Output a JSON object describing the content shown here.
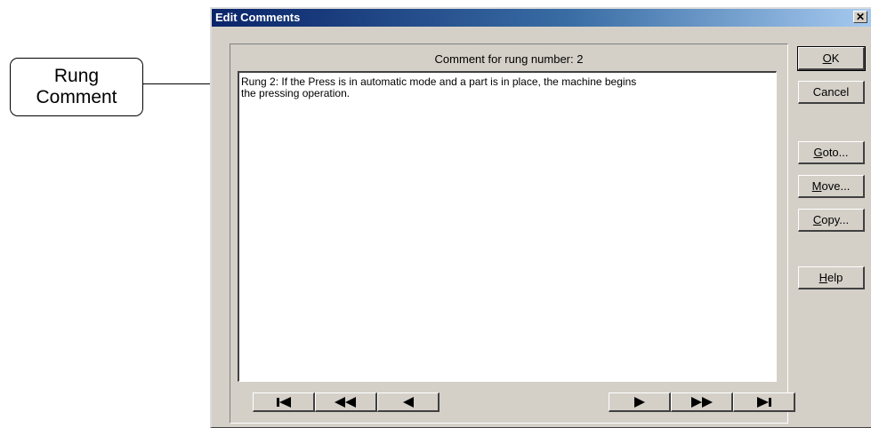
{
  "callout": {
    "line1": "Rung",
    "line2": "Comment"
  },
  "window": {
    "title": "Edit Comments",
    "close_glyph": "✕"
  },
  "panel": {
    "label": "Comment for rung number: 2",
    "comment_text": "Rung 2: If the Press is in automatic mode and a part is in place, the machine begins\nthe pressing operation."
  },
  "buttons": {
    "ok": {
      "mnemonic": "O",
      "rest": "K"
    },
    "cancel": {
      "label": "Cancel"
    },
    "goto": {
      "mnemonic": "G",
      "rest": "oto..."
    },
    "move": {
      "mnemonic": "M",
      "rest": "ove..."
    },
    "copy": {
      "mnemonic": "C",
      "rest": "opy..."
    },
    "help": {
      "mnemonic": "H",
      "rest": "elp"
    }
  },
  "nav_icons": [
    "first-icon",
    "fast-back-icon",
    "back-icon",
    "forward-icon",
    "fast-forward-icon",
    "last-icon"
  ]
}
